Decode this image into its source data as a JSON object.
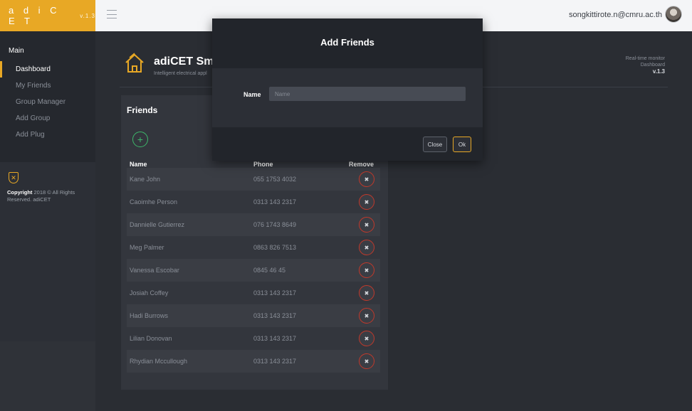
{
  "brand": {
    "name": "a d i C E T",
    "version": "v.1.3"
  },
  "topbar": {
    "user_email": "songkittirote.n@cmru.ac.th"
  },
  "sidebar": {
    "section_label": "Main",
    "items": [
      {
        "label": "Dashboard",
        "active": true
      },
      {
        "label": "My Friends",
        "active": false
      },
      {
        "label": "Group Manager",
        "active": false
      },
      {
        "label": "Add Group",
        "active": false
      },
      {
        "label": "Add Plug",
        "active": false
      }
    ],
    "copyright_bold": "Copyright",
    "copyright_text": " 2018 © All Rights Reserved. adiCET"
  },
  "header": {
    "title": "adiCET Sma",
    "subtitle": "Intelligent electrical appl",
    "right_line1": "Real-time monitor",
    "right_line2": "Dashboard",
    "right_version": "v.1.3"
  },
  "friends": {
    "title": "Friends",
    "columns": {
      "name": "Name",
      "phone": "Phone",
      "remove": "Remove"
    },
    "rows": [
      {
        "name": "Kane John",
        "phone": "055 1753 4032"
      },
      {
        "name": "Caoimhe Person",
        "phone": "0313 143 2317"
      },
      {
        "name": "Dannielle Gutierrez",
        "phone": "076 1743 8649"
      },
      {
        "name": "Meg Palmer",
        "phone": "0863 826 7513"
      },
      {
        "name": "Vanessa Escobar",
        "phone": "0845 46 45"
      },
      {
        "name": "Josiah Coffey",
        "phone": "0313 143 2317"
      },
      {
        "name": "Hadi Burrows",
        "phone": "0313 143 2317"
      },
      {
        "name": "Lilian Donovan",
        "phone": "0313 143 2317"
      },
      {
        "name": "Rhydian Mccullough",
        "phone": "0313 143 2317"
      }
    ]
  },
  "modal": {
    "title": "Add Friends",
    "name_label": "Name",
    "name_placeholder": "Name",
    "name_value": "",
    "close_label": "Close",
    "ok_label": "Ok"
  },
  "colors": {
    "accent": "#e8a825",
    "add": "#3db86a",
    "remove": "#c1392b"
  }
}
